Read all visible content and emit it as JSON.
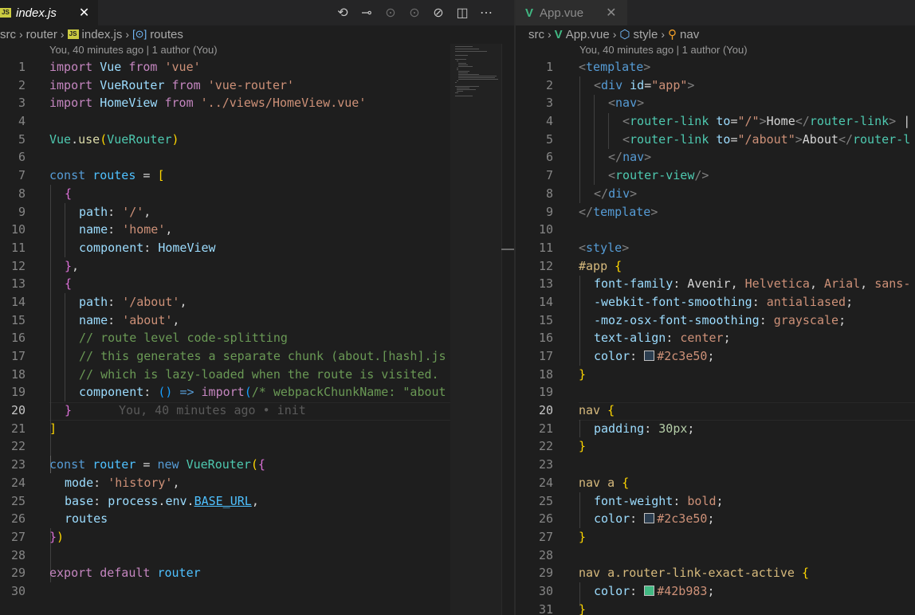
{
  "left": {
    "tab": {
      "label": "index.js",
      "badge": "JS"
    },
    "breadcrumb": [
      "src",
      "router",
      "index.js",
      "routes"
    ],
    "blame": "You, 40 minutes ago | 1 author (You)",
    "inline_blame": "You, 40 minutes ago • init",
    "cursor_line": 20,
    "line_numbers": [
      "1",
      "2",
      "3",
      "4",
      "5",
      "6",
      "7",
      "8",
      "9",
      "10",
      "11",
      "12",
      "13",
      "14",
      "15",
      "16",
      "17",
      "18",
      "19",
      "20",
      "21",
      "22",
      "23",
      "24",
      "25",
      "26",
      "27",
      "28",
      "29",
      "30"
    ]
  },
  "right": {
    "tab": {
      "label": "App.vue"
    },
    "breadcrumb": [
      "src",
      "App.vue",
      "style",
      "nav"
    ],
    "blame": "You, 40 minutes ago | 1 author (You)",
    "cursor_line": 20,
    "line_numbers": [
      "1",
      "2",
      "3",
      "4",
      "5",
      "6",
      "7",
      "8",
      "9",
      "10",
      "11",
      "12",
      "13",
      "14",
      "15",
      "16",
      "17",
      "18",
      "19",
      "20",
      "21",
      "22",
      "23",
      "24",
      "25",
      "26",
      "27",
      "28",
      "29",
      "30",
      "31"
    ]
  },
  "colors": {
    "swatch_dark": "#2c3e50",
    "swatch_green": "#42b983"
  },
  "icons": {
    "close": "close-icon",
    "timeline": "history-icon",
    "compare": "git-compare-icon",
    "split": "split-editor-icon",
    "more": "more-icon"
  }
}
